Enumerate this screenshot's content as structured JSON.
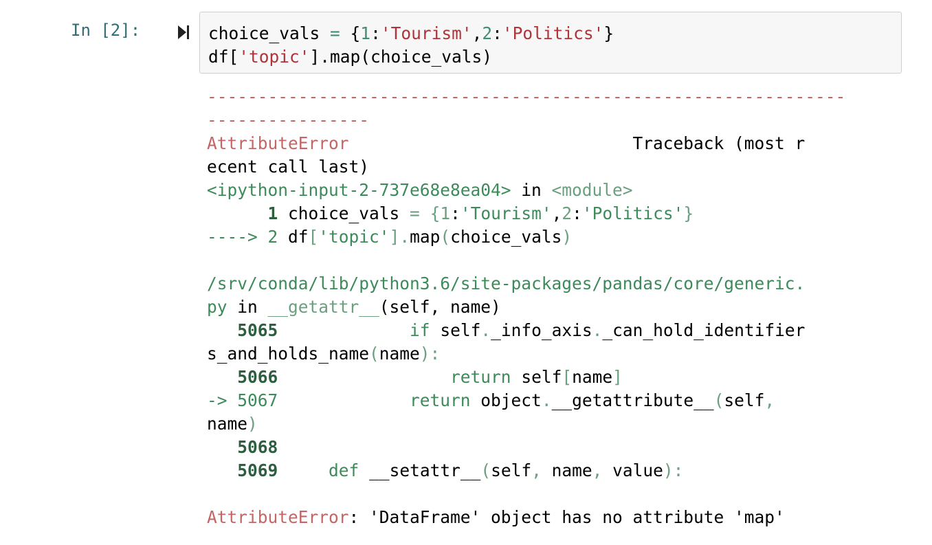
{
  "cell": {
    "prompt": "In [2]:",
    "input_lines": [
      [
        {
          "t": "choice_vals ",
          "c": ""
        },
        {
          "t": "=",
          "c": "teal"
        },
        {
          "t": " {",
          "c": ""
        },
        {
          "t": "1",
          "c": "teal"
        },
        {
          "t": ":",
          "c": ""
        },
        {
          "t": "'Tourism'",
          "c": "str"
        },
        {
          "t": ",",
          "c": ""
        },
        {
          "t": "2",
          "c": "teal"
        },
        {
          "t": ":",
          "c": ""
        },
        {
          "t": "'Politics'",
          "c": "str"
        },
        {
          "t": "}",
          "c": ""
        }
      ],
      [
        {
          "t": "df[",
          "c": ""
        },
        {
          "t": "'topic'",
          "c": "str"
        },
        {
          "t": "].map(choice_vals)",
          "c": ""
        }
      ]
    ]
  },
  "traceback": {
    "lines": [
      [
        {
          "t": "---------------------------------------------------------------",
          "c": "red-light"
        }
      ],
      [
        {
          "t": "----------------",
          "c": "red-light"
        }
      ],
      [
        {
          "t": "AttributeError",
          "c": "red-light"
        },
        {
          "t": "                            Traceback (most r",
          "c": ""
        }
      ],
      [
        {
          "t": "ecent call last)",
          "c": ""
        }
      ],
      [
        {
          "t": "<ipython-input-2-737e68e8ea04>",
          "c": "green"
        },
        {
          "t": " in ",
          "c": ""
        },
        {
          "t": "<module>",
          "c": "gray-green"
        }
      ],
      [
        {
          "t": "      ",
          "c": ""
        },
        {
          "t": "1",
          "c": "green-bold"
        },
        {
          "t": " choice_vals ",
          "c": ""
        },
        {
          "t": "=",
          "c": "gray-green"
        },
        {
          "t": " {",
          "c": "gray-green"
        },
        {
          "t": "1",
          "c": "gray-green"
        },
        {
          "t": ":",
          "c": ""
        },
        {
          "t": "'Tourism'",
          "c": "green"
        },
        {
          "t": ",",
          "c": ""
        },
        {
          "t": "2",
          "c": "gray-green"
        },
        {
          "t": ":",
          "c": ""
        },
        {
          "t": "'Politics'",
          "c": "green"
        },
        {
          "t": "}",
          "c": "gray-green"
        }
      ],
      [
        {
          "t": "----> 2",
          "c": "green"
        },
        {
          "t": " df",
          "c": ""
        },
        {
          "t": "[",
          "c": "gray-green"
        },
        {
          "t": "'topic'",
          "c": "green"
        },
        {
          "t": "]",
          "c": "gray-green"
        },
        {
          "t": ".",
          "c": "gray-green"
        },
        {
          "t": "map",
          "c": ""
        },
        {
          "t": "(",
          "c": "gray-green"
        },
        {
          "t": "choice_vals",
          "c": ""
        },
        {
          "t": ")",
          "c": "gray-green"
        }
      ],
      [
        {
          "t": "",
          "c": ""
        }
      ],
      [
        {
          "t": "/srv/conda/lib/python3.6/site-packages/pandas/core/generic.",
          "c": "green"
        }
      ],
      [
        {
          "t": "py",
          "c": "green"
        },
        {
          "t": " in ",
          "c": ""
        },
        {
          "t": "__getattr__",
          "c": "gray-green"
        },
        {
          "t": "(self, name)",
          "c": ""
        }
      ],
      [
        {
          "t": "   ",
          "c": ""
        },
        {
          "t": "5065",
          "c": "green-bold"
        },
        {
          "t": "             ",
          "c": ""
        },
        {
          "t": "if",
          "c": "green"
        },
        {
          "t": " self",
          "c": ""
        },
        {
          "t": ".",
          "c": "gray-green"
        },
        {
          "t": "_info_axis",
          "c": ""
        },
        {
          "t": ".",
          "c": "gray-green"
        },
        {
          "t": "_can_hold_identifier",
          "c": ""
        }
      ],
      [
        {
          "t": "s_and_holds_name",
          "c": ""
        },
        {
          "t": "(",
          "c": "gray-green"
        },
        {
          "t": "name",
          "c": ""
        },
        {
          "t": "):",
          "c": "gray-green"
        }
      ],
      [
        {
          "t": "   ",
          "c": ""
        },
        {
          "t": "5066",
          "c": "green-bold"
        },
        {
          "t": "                 ",
          "c": ""
        },
        {
          "t": "return",
          "c": "green"
        },
        {
          "t": " self",
          "c": ""
        },
        {
          "t": "[",
          "c": "gray-green"
        },
        {
          "t": "name",
          "c": ""
        },
        {
          "t": "]",
          "c": "gray-green"
        }
      ],
      [
        {
          "t": "-> 5067",
          "c": "green"
        },
        {
          "t": "             ",
          "c": ""
        },
        {
          "t": "return",
          "c": "green"
        },
        {
          "t": " object",
          "c": ""
        },
        {
          "t": ".",
          "c": "gray-green"
        },
        {
          "t": "__getattribute__",
          "c": ""
        },
        {
          "t": "(",
          "c": "gray-green"
        },
        {
          "t": "self",
          "c": ""
        },
        {
          "t": ",",
          "c": "gray-green"
        }
      ],
      [
        {
          "t": "name",
          "c": ""
        },
        {
          "t": ")",
          "c": "gray-green"
        }
      ],
      [
        {
          "t": "   ",
          "c": ""
        },
        {
          "t": "5068",
          "c": "green-bold"
        }
      ],
      [
        {
          "t": "   ",
          "c": ""
        },
        {
          "t": "5069",
          "c": "green-bold"
        },
        {
          "t": "     ",
          "c": ""
        },
        {
          "t": "def",
          "c": "green"
        },
        {
          "t": " __setattr__",
          "c": ""
        },
        {
          "t": "(",
          "c": "gray-green"
        },
        {
          "t": "self",
          "c": ""
        },
        {
          "t": ",",
          "c": "gray-green"
        },
        {
          "t": " name",
          "c": ""
        },
        {
          "t": ",",
          "c": "gray-green"
        },
        {
          "t": " value",
          "c": ""
        },
        {
          "t": "):",
          "c": "gray-green"
        }
      ],
      [
        {
          "t": "",
          "c": ""
        }
      ],
      [
        {
          "t": "AttributeError",
          "c": "red-light"
        },
        {
          "t": ": 'DataFrame' object has no attribute 'map'",
          "c": ""
        }
      ]
    ]
  },
  "colors": {
    "input_bg": "#f7f7f7",
    "input_border": "#cfcfcf",
    "error_red": "#c56565",
    "traceback_green": "#3d8a5a"
  },
  "icons": {
    "run": "step-forward-icon"
  }
}
